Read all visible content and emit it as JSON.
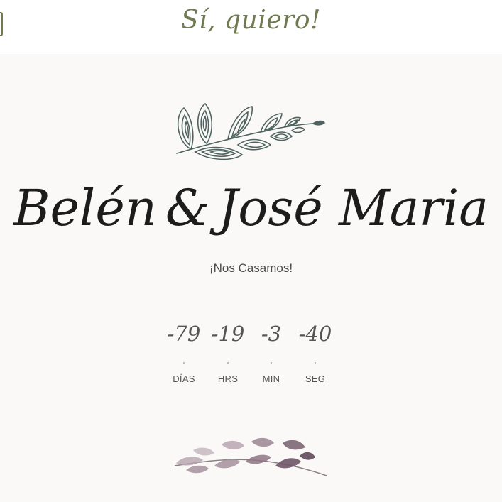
{
  "header": {
    "logo_text": "Sí, quiero!",
    "accent_color": "#6f7a52"
  },
  "hero": {
    "top_ornament_icon": "olive-branch-icon",
    "couple": {
      "name_1": "Belén",
      "ampersand": "&",
      "name_2": "José Maria"
    },
    "subtitle": "¡Nos Casamos!",
    "countdown": [
      {
        "value": "-79",
        "label": "DÍAS"
      },
      {
        "value": "-19",
        "label": "HRS"
      },
      {
        "value": "-3",
        "label": "MIN"
      },
      {
        "value": "-40",
        "label": "SEG"
      }
    ],
    "bottom_ornament_icon": "lavender-branch-icon"
  }
}
